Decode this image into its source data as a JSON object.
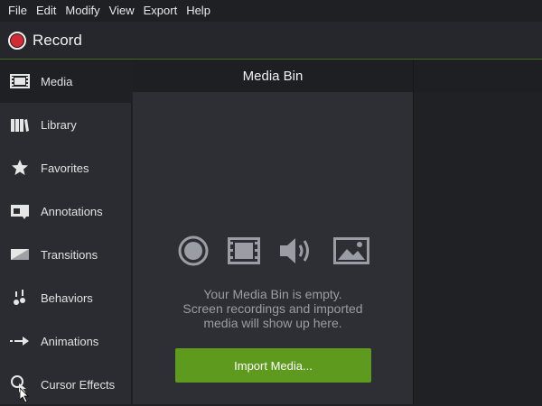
{
  "menu": {
    "items": [
      "File",
      "Edit",
      "Modify",
      "View",
      "Export",
      "Help"
    ]
  },
  "record": {
    "label": "Record"
  },
  "sidebar": {
    "items": [
      {
        "label": "Media",
        "icon": "filmstrip-icon",
        "active": true
      },
      {
        "label": "Library",
        "icon": "books-icon"
      },
      {
        "label": "Favorites",
        "icon": "star-icon"
      },
      {
        "label": "Annotations",
        "icon": "annotation-icon"
      },
      {
        "label": "Transitions",
        "icon": "transition-icon"
      },
      {
        "label": "Behaviors",
        "icon": "behaviors-icon"
      },
      {
        "label": "Animations",
        "icon": "animation-arrow-icon"
      },
      {
        "label": "Cursor Effects",
        "icon": "cursor-effects-icon"
      }
    ]
  },
  "media_bin": {
    "title": "Media Bin",
    "message_line1": "Your Media Bin is empty.",
    "message_line2": "Screen recordings and imported",
    "message_line3": "media will show up here.",
    "import_label": "Import Media...",
    "icons": [
      "record-circle-icon",
      "filmstrip-icon",
      "audio-icon",
      "image-icon"
    ]
  },
  "colors": {
    "accent_green": "#5e9a1e",
    "record_red": "#d22b35",
    "panel_bg": "#2d2f34"
  }
}
